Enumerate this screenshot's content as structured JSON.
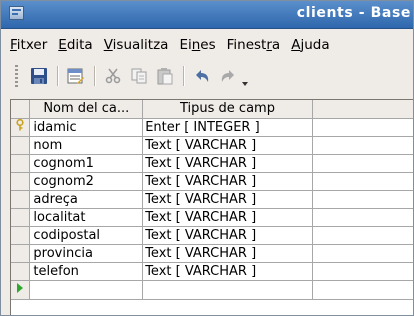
{
  "window": {
    "title": "clients - Base"
  },
  "menu": [
    {
      "before": "",
      "underline": "F",
      "after": "itxer"
    },
    {
      "before": "",
      "underline": "E",
      "after": "dita"
    },
    {
      "before": "",
      "underline": "V",
      "after": "isualitza"
    },
    {
      "before": "Ei",
      "underline": "n",
      "after": "es"
    },
    {
      "before": "Finest",
      "underline": "r",
      "after": "a"
    },
    {
      "before": "",
      "underline": "A",
      "after": "juda"
    }
  ],
  "toolbar": {
    "icons": [
      "save-icon",
      "index-design-icon",
      "cut-icon",
      "copy-icon",
      "paste-icon",
      "undo-icon",
      "redo-icon",
      "dropdown-arrow-icon"
    ]
  },
  "table": {
    "headers": [
      "Nom del ca...",
      "Tipus de camp"
    ],
    "rows": [
      {
        "name": "idamic",
        "type": "Enter [ INTEGER ]",
        "primary_key": true
      },
      {
        "name": "nom",
        "type": "Text [ VARCHAR ]"
      },
      {
        "name": "cognom1",
        "type": "Text [ VARCHAR ]"
      },
      {
        "name": "cognom2",
        "type": "Text [ VARCHAR ]"
      },
      {
        "name": "adreça",
        "type": "Text [ VARCHAR ]"
      },
      {
        "name": "localitat",
        "type": "Text [ VARCHAR ]"
      },
      {
        "name": "codipostal",
        "type": "Text [ VARCHAR ]"
      },
      {
        "name": "provincia",
        "type": "Text [ VARCHAR ]"
      },
      {
        "name": "telefon",
        "type": "Text [ VARCHAR ]"
      }
    ]
  },
  "colors": {
    "titlebar": "#2f67ad",
    "window_bg": "#efebe7",
    "key_icon": "#e8c640",
    "new_row_arrow": "#2fa82f"
  }
}
